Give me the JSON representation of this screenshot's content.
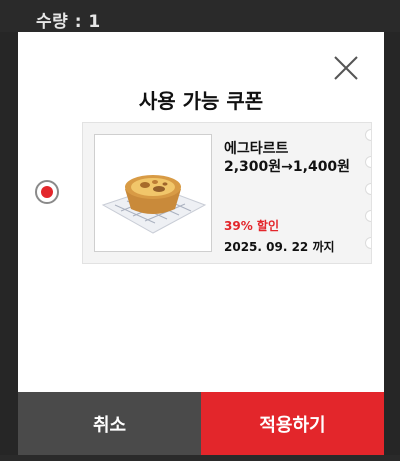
{
  "background": {
    "quantity_label": "수량 : 1"
  },
  "modal": {
    "title": "사용 가능 쿠폰",
    "close_icon": "close-icon",
    "coupon": {
      "selected": true,
      "image_icon": "egg-tart-image",
      "name": "에그타르트",
      "price": "2,300원→1,400원",
      "discount": "39% 할인",
      "expiry": "2025. 09. 22 까지"
    },
    "buttons": {
      "cancel_label": "취소",
      "apply_label": "적용하기"
    }
  },
  "colors": {
    "accent": "#e3262b",
    "cancel_bg": "#4a4a4a",
    "overlay": "#2e2e2e"
  }
}
